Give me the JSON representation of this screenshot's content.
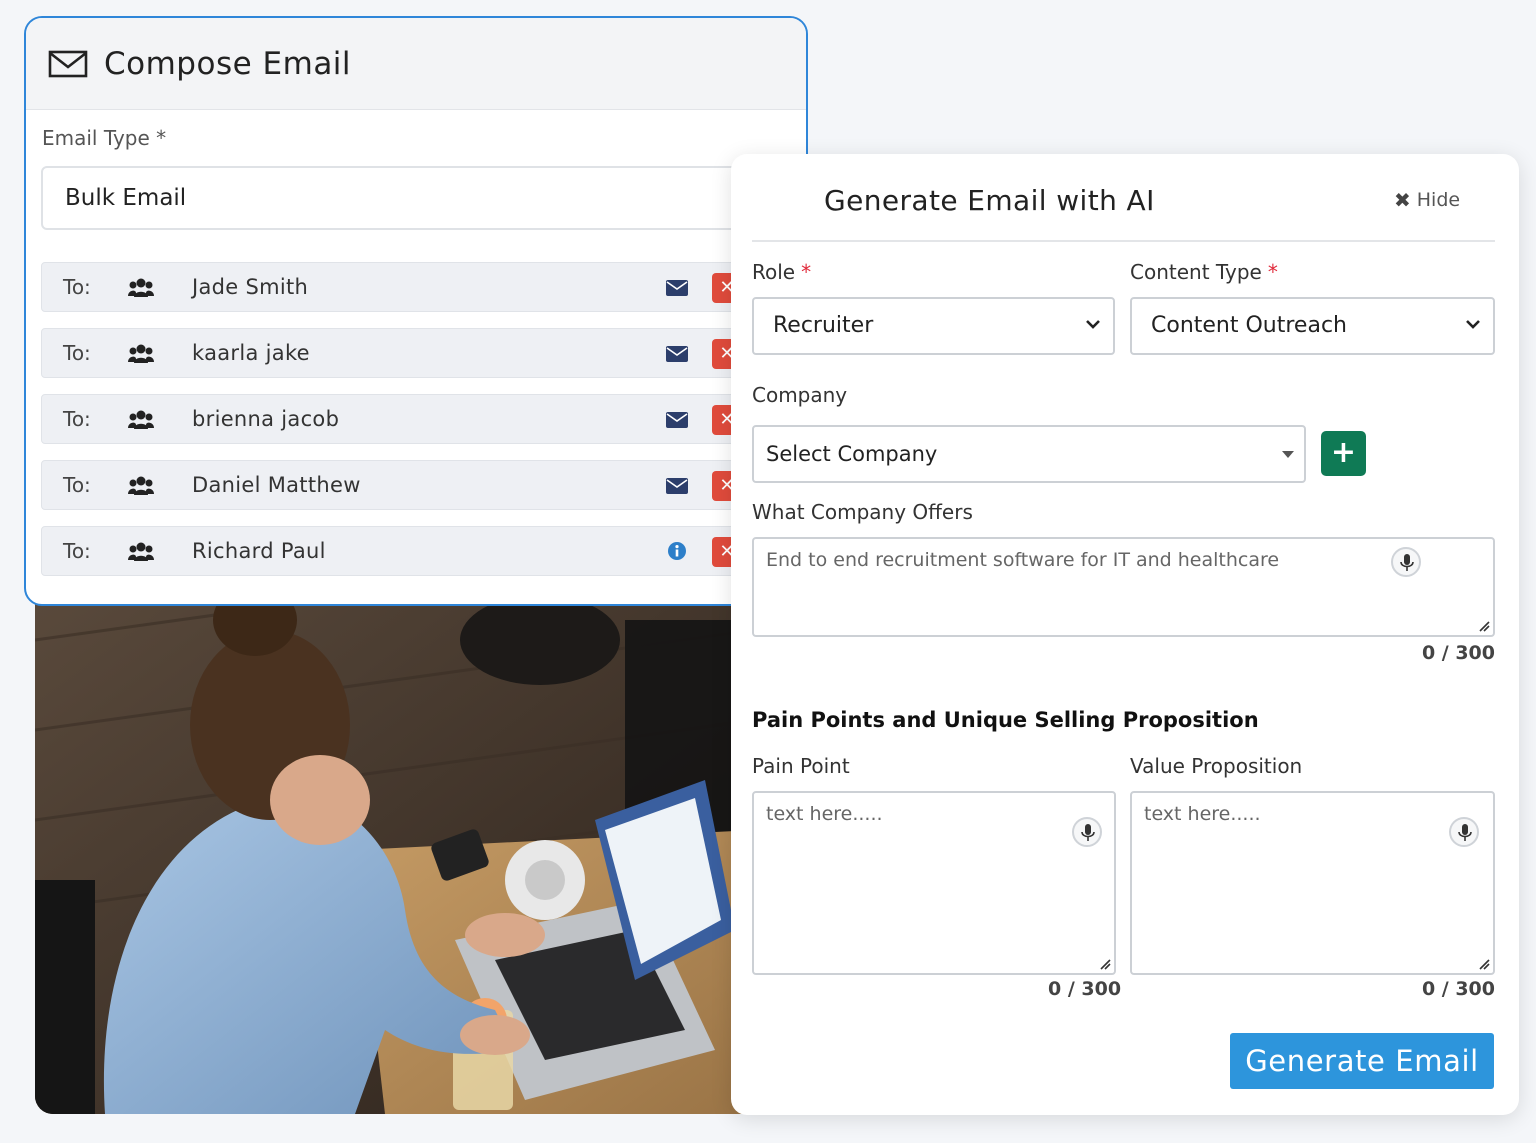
{
  "compose": {
    "title": "Compose Email",
    "email_type_label": "Email Type *",
    "email_type_value": "Bulk Email",
    "to_label": "To:",
    "recipients": [
      {
        "name": "Jade Smith",
        "status": "envelope-icon"
      },
      {
        "name": "kaarla jake",
        "status": "envelope-icon"
      },
      {
        "name": "brienna jacob",
        "status": "envelope-icon"
      },
      {
        "name": "Daniel Matthew",
        "status": "envelope-icon"
      },
      {
        "name": "Richard Paul",
        "status": "info-icon"
      }
    ]
  },
  "ai_panel": {
    "title": "Generate Email with AI",
    "hide_label": "Hide",
    "role_label": "Role",
    "role_value": "Recruiter",
    "content_type_label": "Content Type",
    "content_type_value": "Content Outreach",
    "required_mark": "*",
    "company_label": "Company",
    "company_value": "Select Company",
    "add_company_label": "+",
    "offers_label": "What Company Offers",
    "offers_placeholder": "End to end recruitment software for IT and healthcare",
    "offers_counter": "0 / 300",
    "section_title": "Pain Points and Unique Selling Proposition",
    "pain_point_label": "Pain Point",
    "pain_point_placeholder": "text here.....",
    "pain_point_counter": "0 / 300",
    "value_prop_label": "Value Proposition",
    "value_prop_placeholder": "text here.....",
    "value_prop_counter": "0 / 300",
    "generate_button": "Generate Email"
  },
  "colors": {
    "accent_blue": "#2d95dc",
    "compose_border": "#2f86d9",
    "add_button_green": "#0f7a55",
    "delete_red": "#e04b3c",
    "required_red": "#e0293a",
    "envelope_navy": "#2c3e6b"
  }
}
